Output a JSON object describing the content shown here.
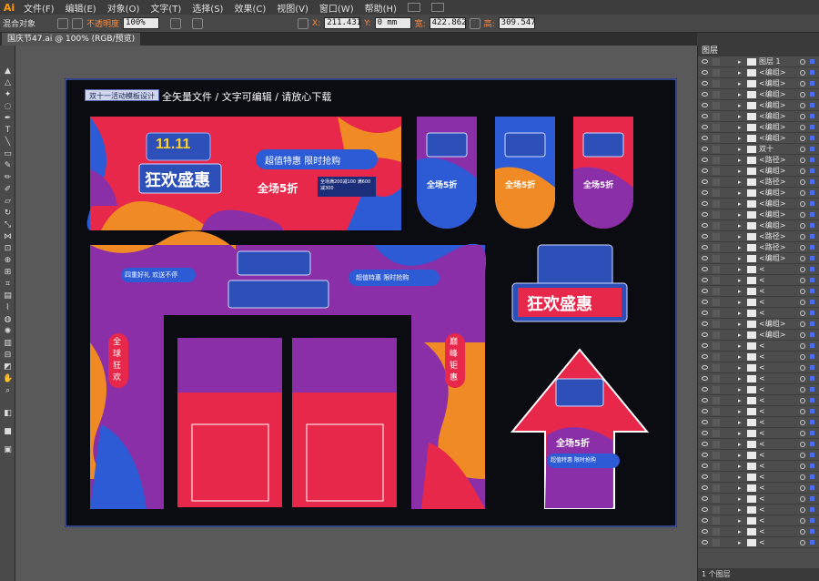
{
  "app": {
    "logo": "Ai"
  },
  "menu": [
    "文件(F)",
    "编辑(E)",
    "对象(O)",
    "文字(T)",
    "选择(S)",
    "效果(C)",
    "视图(V)",
    "窗口(W)",
    "帮助(H)"
  ],
  "control_bar": {
    "mode": "混合对象",
    "opacity_label": "不透明度",
    "opacity_value": "100%",
    "x_label": "X:",
    "x_value": "211.431",
    "y_label": "Y:",
    "y_value": "0 mm",
    "w_label": "宽:",
    "w_value": "422.862",
    "h_label": "高:",
    "h_value": "309.547"
  },
  "document_tab": "国庆节47.ai @ 100% (RGB/预览)",
  "artboard": {
    "badge": "双十一活动模板设计",
    "title": "全矢量文件 / 文字可编辑 / 请放心下载",
    "banner": {
      "logo": "11.11",
      "headline": "狂欢盛惠",
      "pill": "超值特惠 限时抢购",
      "discount": "全场5折",
      "coupon": "全场满200减100 满600减300"
    },
    "arch": {
      "top_left": "四重好礼 欢送不停",
      "pill": "超值特惠 限时抢购",
      "left_side": "全球狂欢",
      "right_side": "巅峰钜惠"
    },
    "flags": [
      "全场5折",
      "全场5折",
      "全场5折"
    ],
    "standee_headline": "狂欢盛惠",
    "arrow_sign": {
      "discount": "全场5折",
      "pill": "超值特惠 限时抢购"
    }
  },
  "layers": {
    "panel_title": "图层",
    "footer": "1 个图层",
    "rows": [
      {
        "name": "图层 1"
      },
      {
        "name": "<编组>"
      },
      {
        "name": "<编组>"
      },
      {
        "name": "<编组>"
      },
      {
        "name": "<编组>"
      },
      {
        "name": "<编组>"
      },
      {
        "name": "<编组>"
      },
      {
        "name": "<编组>"
      },
      {
        "name": "双十"
      },
      {
        "name": "<路径>"
      },
      {
        "name": "<编组>"
      },
      {
        "name": "<路径>"
      },
      {
        "name": "<编组>"
      },
      {
        "name": "<编组>"
      },
      {
        "name": "<编组>"
      },
      {
        "name": "<编组>"
      },
      {
        "name": "<路径>"
      },
      {
        "name": "<路径>"
      },
      {
        "name": "<编组>"
      },
      {
        "name": "<"
      },
      {
        "name": "<"
      },
      {
        "name": "<"
      },
      {
        "name": "<"
      },
      {
        "name": "<"
      },
      {
        "name": "<编组>"
      },
      {
        "name": "<编组>"
      },
      {
        "name": "<"
      },
      {
        "name": "<"
      },
      {
        "name": "<"
      },
      {
        "name": "<"
      },
      {
        "name": "<"
      },
      {
        "name": "<"
      },
      {
        "name": "<"
      },
      {
        "name": "<"
      },
      {
        "name": "<"
      },
      {
        "name": "<"
      },
      {
        "name": "<"
      },
      {
        "name": "<"
      },
      {
        "name": "<"
      },
      {
        "name": "<"
      },
      {
        "name": "<"
      },
      {
        "name": "<"
      },
      {
        "name": "<"
      },
      {
        "name": "<"
      },
      {
        "name": "<"
      }
    ]
  },
  "colors": {
    "selection": "#5b7cff",
    "artboard": "#0b0b12",
    "accent_red": "#e8284a",
    "accent_purple": "#8a2fa8",
    "accent_blue": "#2d5bd6",
    "accent_orange": "#f08a24"
  }
}
